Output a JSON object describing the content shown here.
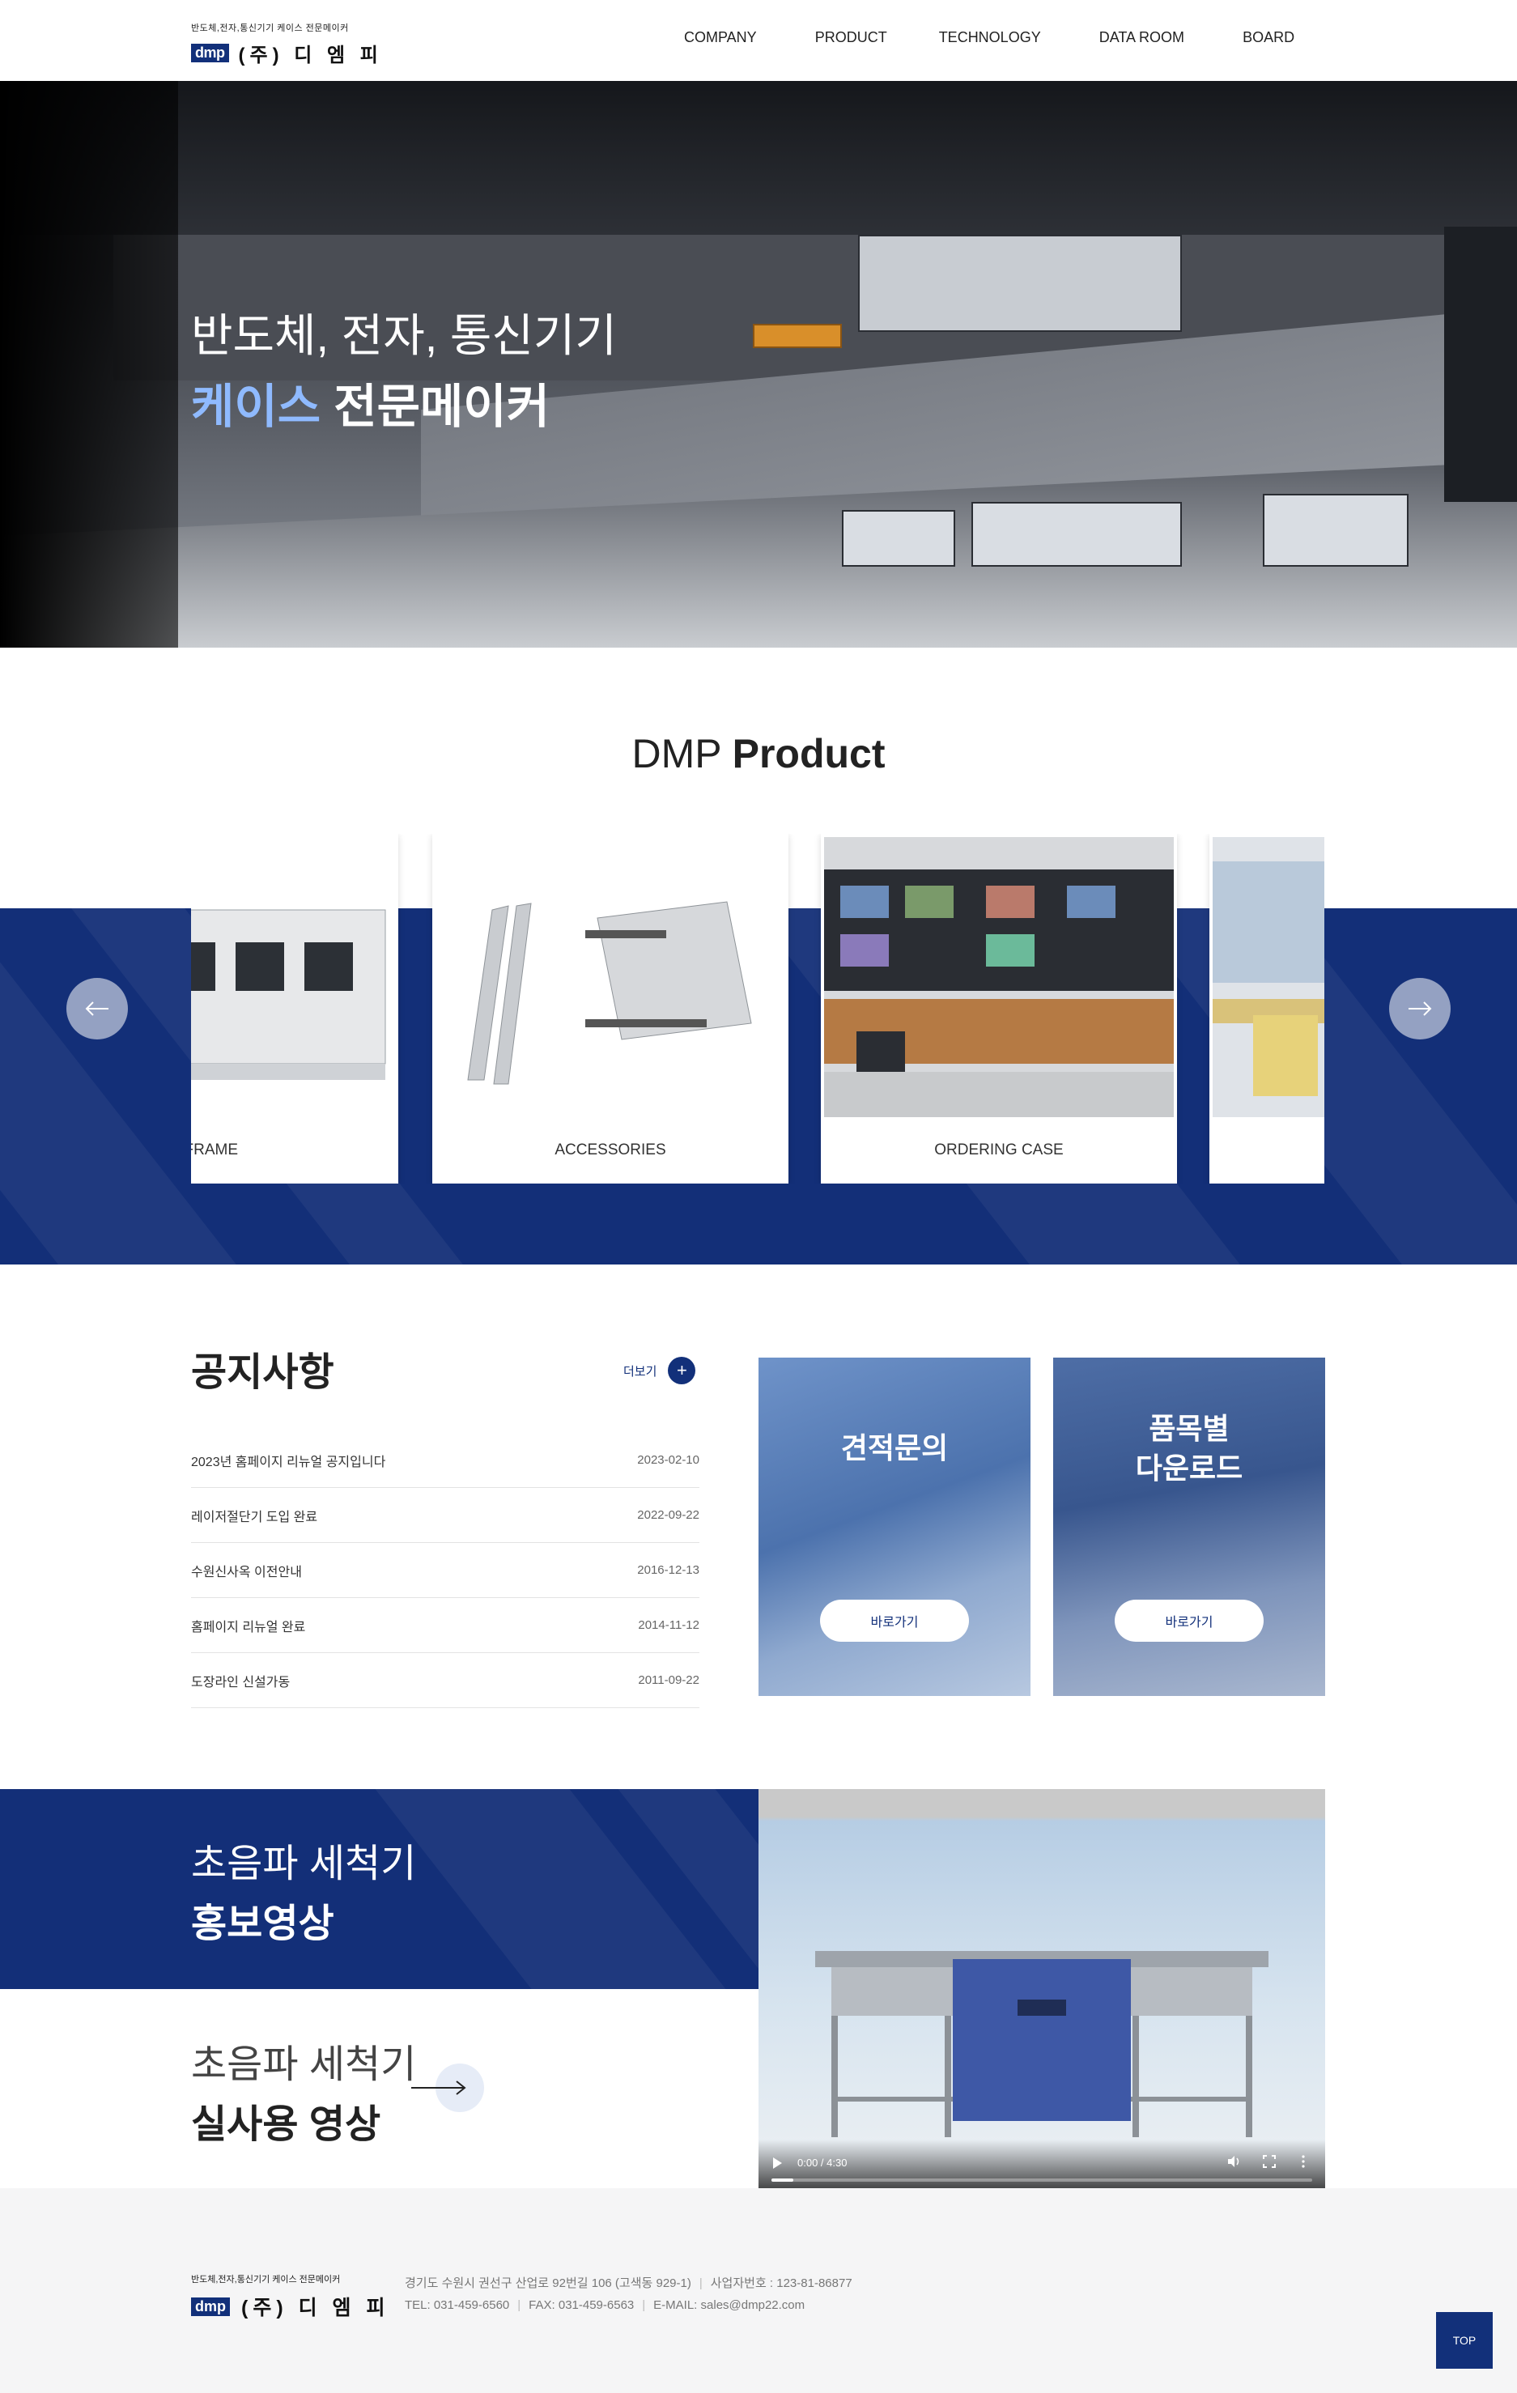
{
  "header": {
    "logo_tagline": "반도체,전자,통신기기 케이스 전문메이커",
    "logo_mark": "dmp",
    "logo_name": "(주) 디 엠 피",
    "nav": [
      "COMPANY",
      "PRODUCT",
      "TECHNOLOGY",
      "DATA ROOM",
      "BOARD"
    ]
  },
  "hero": {
    "line1": "반도체, 전자, 통신기기",
    "line2_accent": "케이스",
    "line2_rest": " 전문메이커"
  },
  "product": {
    "title_light": "DMP ",
    "title_bold": "Product",
    "cards": [
      "FRAME",
      "ACCESSORIES",
      "ORDERING CASE",
      ""
    ],
    "prev_icon": "arrow-left-icon",
    "next_icon": "arrow-right-icon"
  },
  "notice": {
    "title": "공지사항",
    "more_label": "더보기",
    "more_icon": "+",
    "items": [
      {
        "title": "2023년 홈페이지 리뉴얼 공지입니다",
        "date": "2023-02-10"
      },
      {
        "title": "레이저절단기 도입 완료",
        "date": "2022-09-22"
      },
      {
        "title": "수원신사옥 이전안내",
        "date": "2016-12-13"
      },
      {
        "title": "홈페이지 리뉴얼 완료",
        "date": "2014-11-12"
      },
      {
        "title": "도장라인 신설가동",
        "date": "2011-09-22"
      }
    ]
  },
  "quick": {
    "estimate": {
      "title": "견적문의",
      "button": "바로가기"
    },
    "download": {
      "title_line1": "품목별",
      "title_line2": "다운로드",
      "button": "바로가기"
    }
  },
  "video_section": {
    "promo_line1": "초음파 세척기",
    "promo_line2": "홍보영상",
    "real_line1": "초음파 세척기",
    "real_line2": "실사용 영상",
    "player_time": "0:00 / 4:30",
    "progress": 0.04
  },
  "footer": {
    "logo_tagline": "반도체,전자,통신기기 케이스 전문메이커",
    "logo_mark": "dmp",
    "logo_name": "(주) 디 엠 피",
    "address": "경기도 수원시 권선구 산업로 92번길 106 (고색동 929-1)",
    "business_no": "사업자번호 : 123-81-86877",
    "tel": "TEL: 031-459-6560",
    "fax": "FAX: 031-459-6563",
    "email": "E-MAIL: sales@dmp22.com",
    "top_label": "TOP"
  },
  "colors": {
    "brand": "#12307a",
    "accent": "#8fbaff"
  }
}
